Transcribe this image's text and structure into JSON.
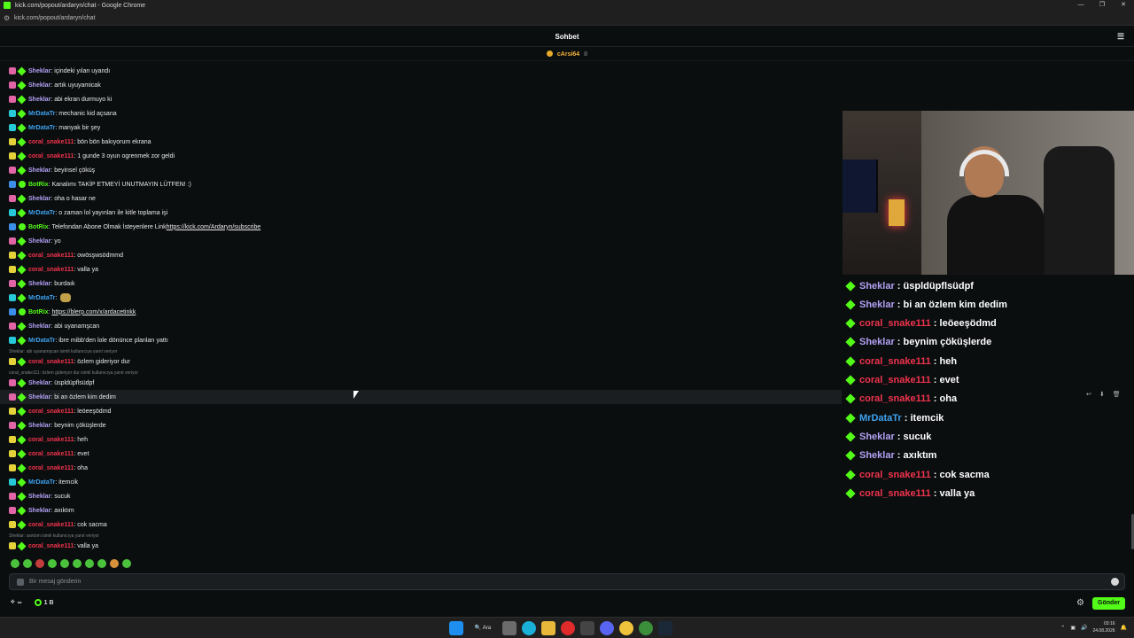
{
  "window": {
    "title": "kick.com/popout/ardaryn/chat - Google Chrome",
    "url": "kick.com/popout/ardaryn/chat",
    "controls": [
      "—",
      "❐",
      "✕"
    ]
  },
  "chat": {
    "title": "Sohbet",
    "pinned_user": "cArsi64",
    "pinned_count": "8",
    "input_placeholder": "Bir mesaj gönderin",
    "viewer_infinity": "∞",
    "points_count": "1 B",
    "send_label": "Gönder"
  },
  "messages": [
    {
      "badge": "pink",
      "user": "Sheklar",
      "type": "sheklar",
      "text": "içindeki yılan uyandı"
    },
    {
      "badge": "pink",
      "user": "Sheklar",
      "type": "sheklar",
      "text": "artık uyuyamicak"
    },
    {
      "badge": "pink",
      "user": "Sheklar",
      "type": "sheklar",
      "text": "abi ekran durmuyo ki"
    },
    {
      "badge": "teal",
      "user": "MrDataTr",
      "type": "mrdata",
      "text": "mechanic kid açsana"
    },
    {
      "badge": "teal",
      "user": "MrDataTr",
      "type": "mrdata",
      "text": "manyak bir şey"
    },
    {
      "badge": "yellow",
      "user": "coral_snake111",
      "type": "coral",
      "text": "bön bön bakıyorum ekrana"
    },
    {
      "badge": "yellow",
      "user": "coral_snake111",
      "type": "coral",
      "text": "1 gunde 3 oyun ogrenmek zor geldi"
    },
    {
      "badge": "pink",
      "user": "Sheklar",
      "type": "sheklar",
      "text": "beyinsel çöküş"
    },
    {
      "badge": "blue",
      "user": "BotRix",
      "type": "botrix",
      "text": "Kanalımı TAKİP ETMEYİ UNUTMAYIN LÜTFEN! :)"
    },
    {
      "badge": "pink",
      "user": "Sheklar",
      "type": "sheklar",
      "text": "oha o hasar ne"
    },
    {
      "badge": "teal",
      "user": "MrDataTr",
      "type": "mrdata",
      "text": "o zaman lol yayınları ile kitle toplama işi"
    },
    {
      "badge": "blue",
      "user": "BotRix",
      "type": "botrix",
      "text": "Telefondan Abone Olmak İsteyenlere Link ",
      "link": "https://kick.com/Ardaryn/subscribe"
    },
    {
      "badge": "pink",
      "user": "Sheklar",
      "type": "sheklar",
      "text": "yo"
    },
    {
      "badge": "yellow",
      "user": "coral_snake111",
      "type": "coral",
      "text": "owösşwsödmmd"
    },
    {
      "badge": "yellow",
      "user": "coral_snake111",
      "type": "coral",
      "text": "valla ya"
    },
    {
      "badge": "pink",
      "user": "Sheklar",
      "type": "sheklar",
      "text": "burdaık"
    },
    {
      "badge": "teal",
      "user": "MrDataTr",
      "type": "mrdata",
      "text": "",
      "emote": true
    },
    {
      "badge": "blue",
      "user": "BotRix",
      "type": "botrix",
      "text": "",
      "link": "https://blerp.com/x/ardacetinkk"
    },
    {
      "badge": "pink",
      "user": "Sheklar",
      "type": "sheklar",
      "text": "abi uyanamşcan"
    },
    {
      "badge": "teal",
      "user": "MrDataTr",
      "type": "mrdata",
      "text": "ibre mibb'den lole dönünce planları yattı"
    },
    {
      "badge": "yellow",
      "user": "coral_snake111",
      "type": "coral",
      "text": "özlem gideriyor dur"
    },
    {
      "badge": "pink",
      "user": "Sheklar",
      "type": "sheklar",
      "text": "üspldüpflsüdpf"
    },
    {
      "badge": "pink",
      "user": "Sheklar",
      "type": "sheklar",
      "text": "bi an özlem kim dedim"
    },
    {
      "badge": "yellow",
      "user": "coral_snake111",
      "type": "coral",
      "text": "leöeeşödmd"
    },
    {
      "badge": "pink",
      "user": "Sheklar",
      "type": "sheklar",
      "text": "beynim çöküşlerde"
    },
    {
      "badge": "yellow",
      "user": "coral_snake111",
      "type": "coral",
      "text": "heh"
    },
    {
      "badge": "yellow",
      "user": "coral_snake111",
      "type": "coral",
      "text": "evet"
    },
    {
      "badge": "yellow",
      "user": "coral_snake111",
      "type": "coral",
      "text": "oha"
    },
    {
      "badge": "teal",
      "user": "MrDataTr",
      "type": "mrdata",
      "text": "itemcik"
    },
    {
      "badge": "pink",
      "user": "Sheklar",
      "type": "sheklar",
      "text": "sucuk"
    },
    {
      "badge": "pink",
      "user": "Sheklar",
      "type": "sheklar",
      "text": "axıktım"
    },
    {
      "badge": "yellow",
      "user": "coral_snake111",
      "type": "coral",
      "text": "cok sacma"
    },
    {
      "badge": "yellow",
      "user": "coral_snake111",
      "type": "coral",
      "text": "valla ya"
    }
  ],
  "replies": [
    "Sheklar: abi uyanamşcan isimli kullanıcıya yanıt veriyor",
    "coral_snake111: özlem gideriyor dur isimli kullanıcıya yanıt veriyor",
    "Sheklar: axıktım isimli kullanıcıya yanıt veriyor"
  ],
  "overlay": [
    {
      "user": "Sheklar",
      "type": "sheklar",
      "text": "üspldüpflsüdpf"
    },
    {
      "user": "Sheklar",
      "type": "sheklar",
      "text": "bi an özlem kim dedim"
    },
    {
      "user": "coral_snake111",
      "type": "coral",
      "text": "leöeeşödmd"
    },
    {
      "user": "Sheklar",
      "type": "sheklar",
      "text": "beynim çöküşlerde"
    },
    {
      "user": "coral_snake111",
      "type": "coral",
      "text": "heh"
    },
    {
      "user": "coral_snake111",
      "type": "coral",
      "text": "evet"
    },
    {
      "user": "coral_snake111",
      "type": "coral",
      "text": "oha"
    },
    {
      "user": "MrDataTr",
      "type": "mrdata",
      "text": "itemcik"
    },
    {
      "user": "Sheklar",
      "type": "sheklar",
      "text": "sucuk"
    },
    {
      "user": "Sheklar",
      "type": "sheklar",
      "text": "axıktım"
    },
    {
      "user": "coral_snake111",
      "type": "coral",
      "text": "cok sacma"
    },
    {
      "user": "coral_snake111",
      "type": "coral",
      "text": "valla ya"
    }
  ],
  "taskbar": {
    "search_label": "Ara",
    "time": "03:16",
    "date": "24.08.2026"
  },
  "colors": {
    "accent": "#53fc18",
    "sheklar": "#b3a1f5",
    "coral": "#f0334d",
    "mrdata": "#3ea3f0"
  }
}
